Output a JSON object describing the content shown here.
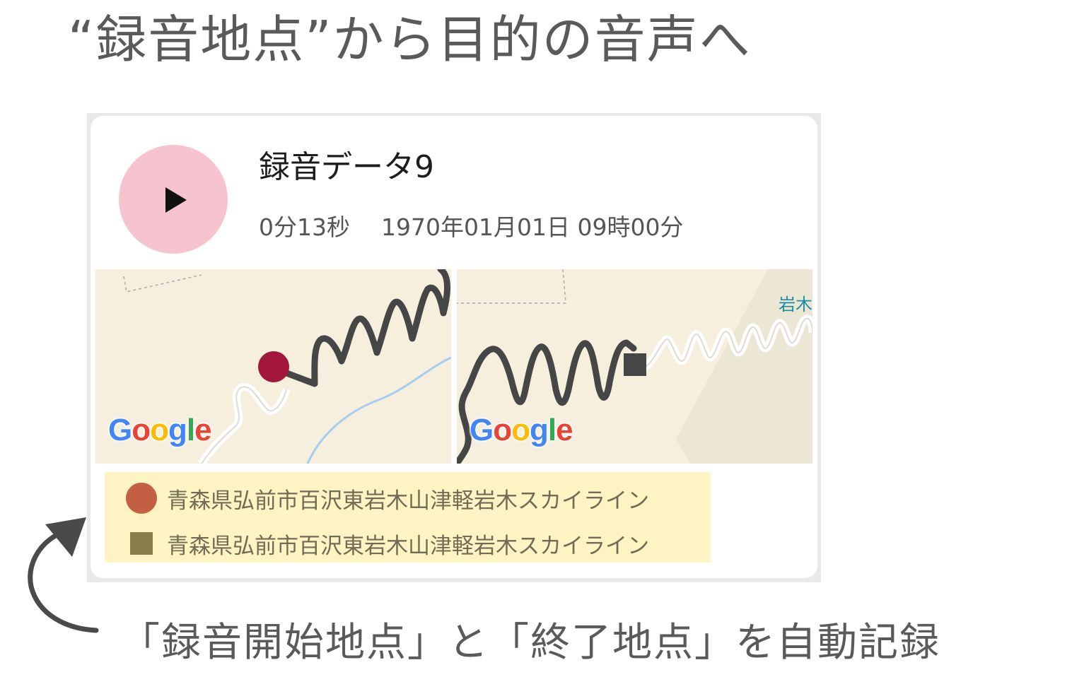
{
  "headline": "“録音地点”から目的の音声へ",
  "recording": {
    "title": "録音データ9",
    "duration": "0分13秒",
    "datetime": "1970年01月01日 09時00分"
  },
  "maps": {
    "google_logo": [
      "G",
      "o",
      "o",
      "g",
      "l",
      "e"
    ],
    "end_map_label": "岩木"
  },
  "locations": {
    "start_address": "青森県弘前市百沢東岩木山津軽岩木スカイライン",
    "end_address": "青森県弘前市百沢東岩木山津軽岩木スカイライン"
  },
  "caption": "「録音開始地点」と「終了地点」を自動記録",
  "colors": {
    "play_button_bg": "#f6c4cf",
    "start_marker": "#a3173c",
    "start_legend_marker": "#c45f43",
    "end_legend_marker": "#8a7d4a",
    "location_box_bg": "#fef3c2",
    "map_bg": "#f6efde",
    "route": "#4a4a4a"
  },
  "icons": {
    "play": "play-icon",
    "start_marker": "circle-marker-icon",
    "end_marker": "square-marker-icon",
    "arrow": "curved-arrow-icon"
  }
}
